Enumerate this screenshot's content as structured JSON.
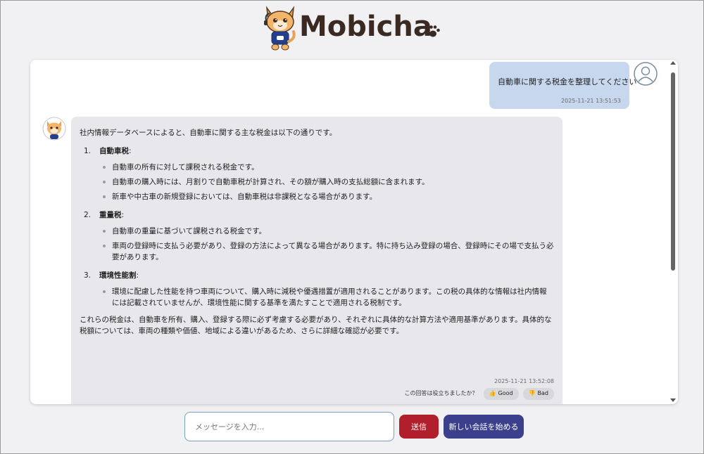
{
  "app": {
    "title": "Mobicha",
    "logo_icon": "cat-mascot-icon",
    "paw_icon": "paw-icon"
  },
  "colors": {
    "user_bubble": "#c7d7ee",
    "bot_bubble": "#e8e8ec",
    "send_button": "#b01f2b",
    "new_chat_button": "#3c3f8c"
  },
  "user_message": {
    "text": "自動車に関する税金を整理してください",
    "timestamp": "2025-11-21 13:51:53",
    "avatar_icon": "user-avatar-icon"
  },
  "bot_message": {
    "avatar_icon": "cat-avatar-icon",
    "intro": "社内情報データベースによると、自動車に関する主な税金は以下の通りです。",
    "sections": [
      {
        "number": "1.",
        "title": "自動車税",
        "suffix": ":",
        "bullets": [
          "自動車の所有に対して課税される税金です。",
          "自動車の購入時には、月割りで自動車税が計算され、その額が購入時の支払総額に含まれます。",
          "新車や中古車の新規登録においては、自動車税は非課税となる場合があります。"
        ]
      },
      {
        "number": "2.",
        "title": "重量税",
        "suffix": ":",
        "bullets": [
          "自動車の重量に基づいて課税される税金です。",
          "車両の登録時に支払う必要があり、登録の方法によって異なる場合があります。特に持ち込み登録の場合、登録時にその場で支払う必要があります。"
        ]
      },
      {
        "number": "3.",
        "title": "環境性能割",
        "suffix": ":",
        "bullets": [
          "環境に配慮した性能を持つ車両について、購入時に減税や優遇措置が適用されることがあります。この税の具体的な情報は社内情報には記載されていませんが、環境性能に関する基準を満たすことで適用される税制です。"
        ]
      }
    ],
    "closing": "これらの税金は、自動車を所有、購入、登録する際に必ず考慮する必要があり、それぞれに具体的な計算方法や適用基準があります。具体的な税額については、車両の種類や価値、地域による違いがあるため、さらに詳細な確認が必要です。",
    "timestamp": "2025-11-21 13:52:08",
    "feedback": {
      "question": "この回答は役立ちましたか？",
      "good_label": "Good",
      "good_icon": "thumbs-up-icon",
      "bad_label": "Bad",
      "bad_icon": "thumbs-down-icon"
    }
  },
  "input_bar": {
    "placeholder": "メッセージを入力...",
    "value": "",
    "send_label": "送信",
    "new_chat_label": "新しい会話を始める"
  }
}
